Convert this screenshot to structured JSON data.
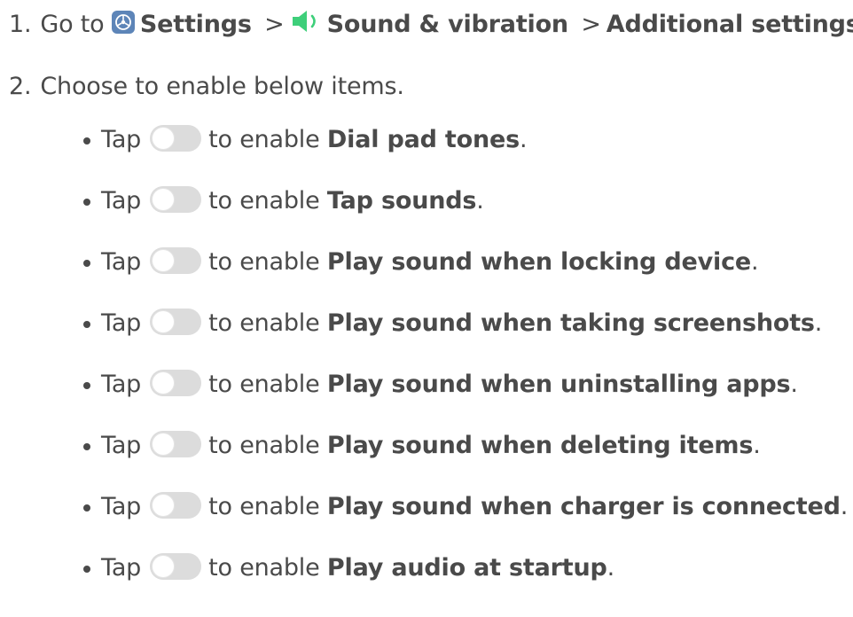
{
  "step1": {
    "number": "1.",
    "prefix": "Go to",
    "settings_icon": "settings-gear-icon",
    "settings_label": "Settings",
    "sep1": ">",
    "sound_icon": "speaker-icon",
    "sound_label": "Sound & vibration",
    "sep2": ">",
    "additional_label": "Additional settings",
    "end": "."
  },
  "step2": {
    "number": "2.",
    "text": "Choose to enable below items."
  },
  "bullets": [
    {
      "tap": "Tap",
      "middle": "to enable",
      "item": "Dial pad tones",
      "end": "."
    },
    {
      "tap": "Tap",
      "middle": "to enable",
      "item": "Tap sounds",
      "end": "."
    },
    {
      "tap": "Tap",
      "middle": "to enable",
      "item": "Play sound when locking device",
      "end": "."
    },
    {
      "tap": "Tap",
      "middle": "to enable",
      "item": "Play sound when taking screenshots",
      "end": "."
    },
    {
      "tap": "Tap",
      "middle": "to enable",
      "item": "Play sound when uninstalling apps",
      "end": "."
    },
    {
      "tap": "Tap",
      "middle": "to enable",
      "item": "Play sound when deleting items",
      "end": "."
    },
    {
      "tap": "Tap",
      "middle": "to enable",
      "item": "Play sound when charger is connected",
      "end": "."
    },
    {
      "tap": "Tap",
      "middle": "to enable",
      "item": "Play audio at startup",
      "end": "."
    }
  ],
  "colors": {
    "text": "#4a4a4a",
    "settings_icon_bg": "#5d85b8",
    "speaker_green": "#3ecf7a",
    "toggle_off": "#dcdcdc"
  }
}
